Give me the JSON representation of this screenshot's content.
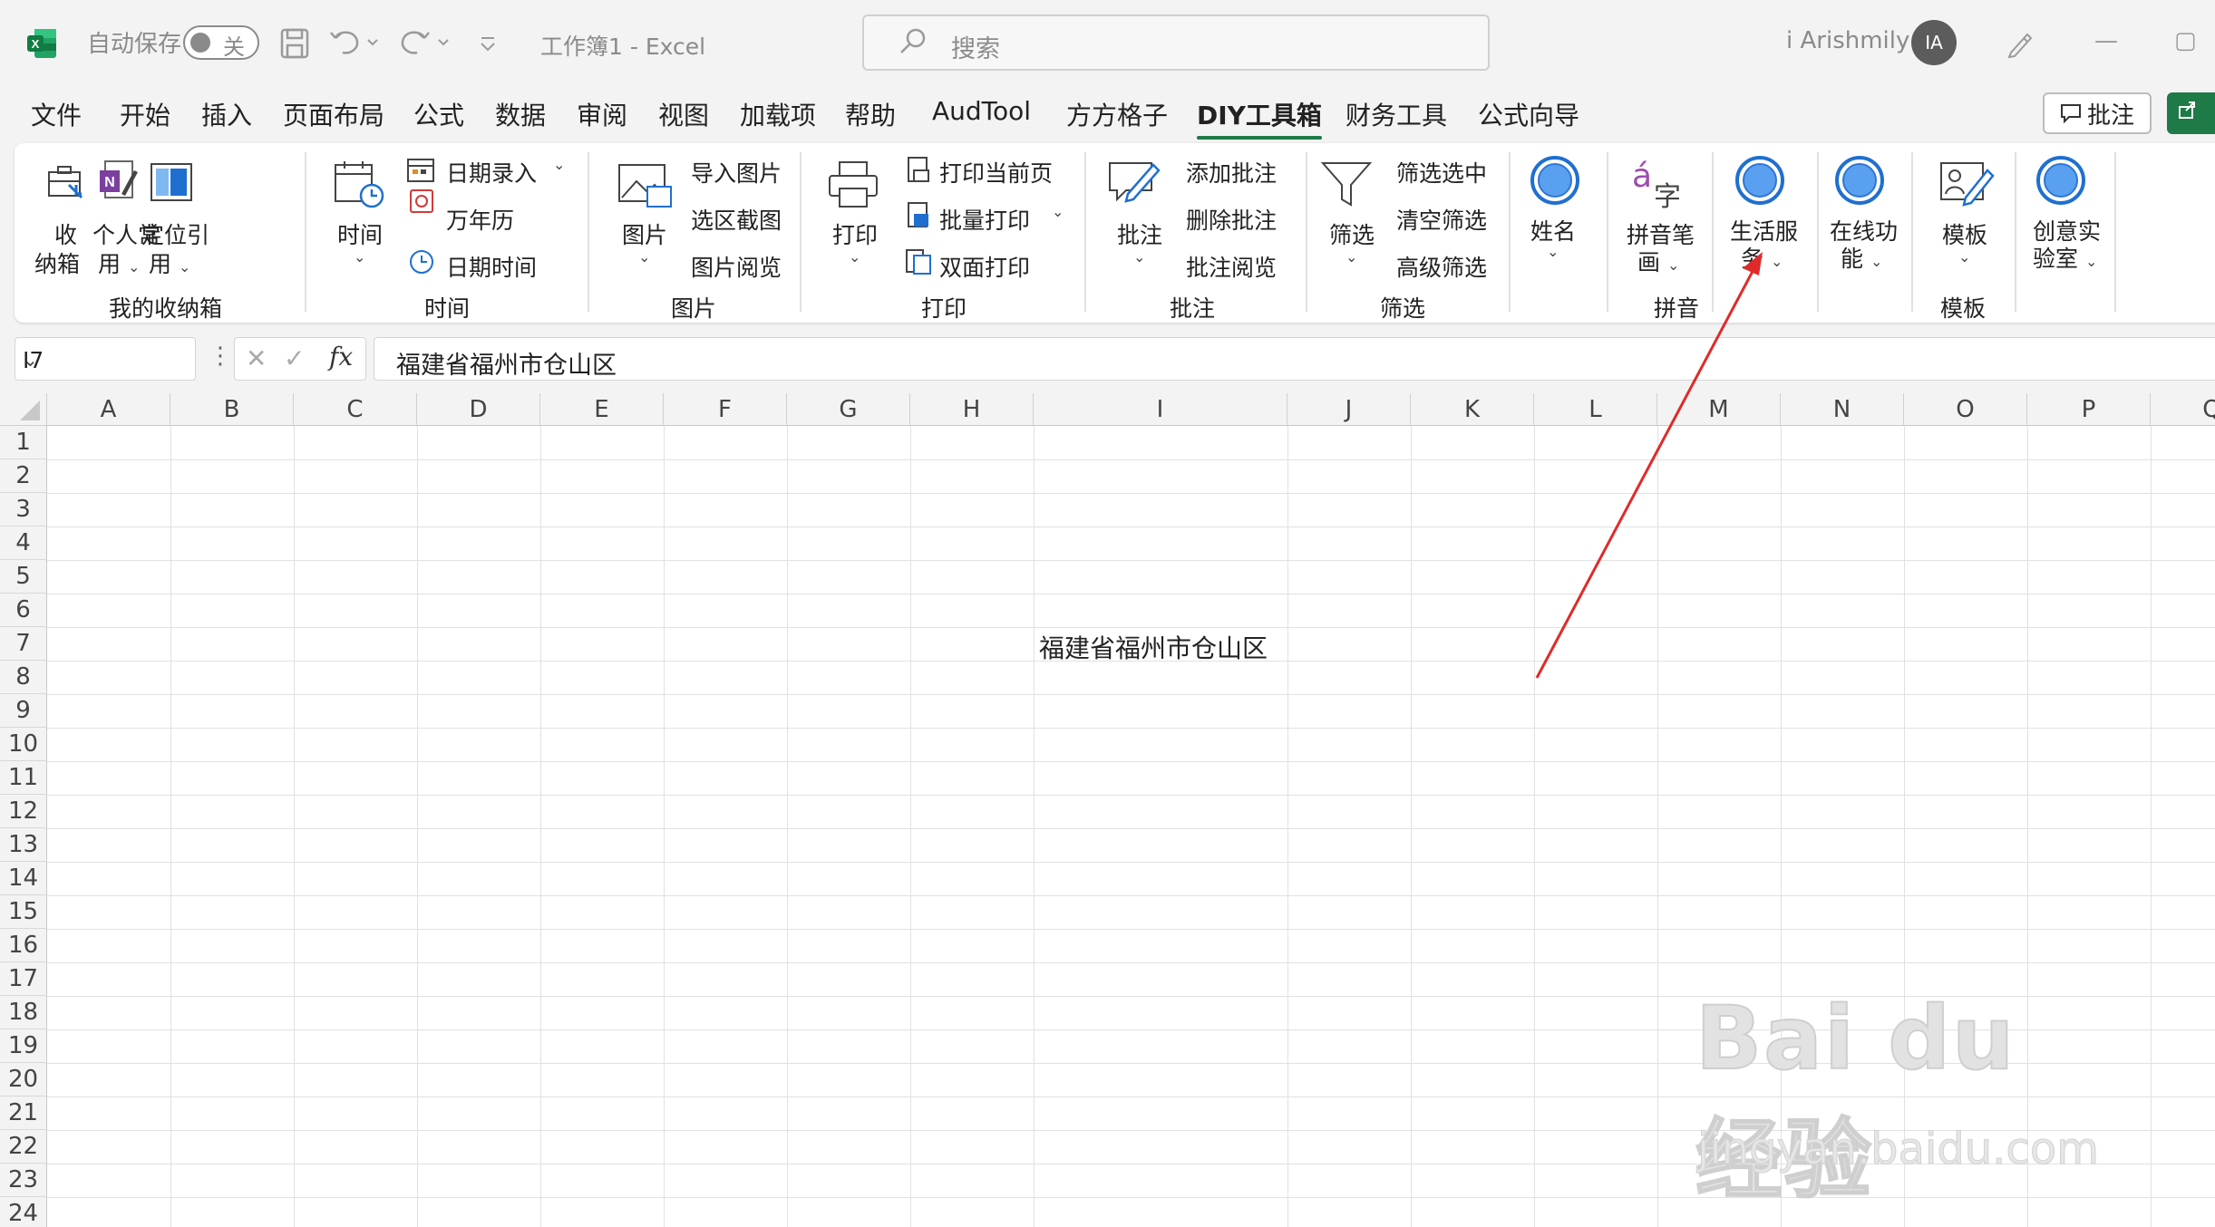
{
  "titlebar": {
    "autosave_label": "自动保存",
    "autosave_state": "关",
    "doc_title": "工作簿1  -  Excel",
    "search_placeholder": "搜索",
    "username": "i Arishmily",
    "avatar_initials": "IA"
  },
  "tabs": [
    "文件",
    "开始",
    "插入",
    "页面布局",
    "公式",
    "数据",
    "审阅",
    "视图",
    "加载项",
    "帮助",
    "AudTool",
    "方方格子",
    "DIY工具箱",
    "财务工具",
    "公式向导"
  ],
  "active_tab": "DIY工具箱",
  "comment_button": "批注",
  "ribbon": {
    "groups": {
      "storage": {
        "title": "我的收纳箱",
        "btn1_l1": "收",
        "btn1_l2": "纳箱",
        "btn2_l1": "个人常",
        "btn2_l2": "用",
        "btn3_l1": "定位引",
        "btn3_l2": "用"
      },
      "time": {
        "title": "时间",
        "big": "时间",
        "item1": "日期录入",
        "item2": "万年历",
        "item3": "日期时间"
      },
      "picture": {
        "title": "图片",
        "big": "图片",
        "item1": "导入图片",
        "item2": "选区截图",
        "item3": "图片阅览"
      },
      "print": {
        "title": "打印",
        "big": "打印",
        "item1": "打印当前页",
        "item2": "批量打印",
        "item3": "双面打印"
      },
      "comment": {
        "title": "批注",
        "big": "批注",
        "item1": "添加批注",
        "item2": "删除批注",
        "item3": "批注阅览"
      },
      "filter": {
        "title": "筛选",
        "big": "筛选",
        "item1": "筛选选中",
        "item2": "清空筛选",
        "item3": "高级筛选"
      },
      "name": {
        "big": "姓名"
      },
      "pinyin": {
        "title": "拼音",
        "big_l1": "拼音笔",
        "big_l2": "画",
        "glyph_a": "á",
        "glyph_zi": "字"
      },
      "life": {
        "big_l1": "生活服",
        "big_l2": "务"
      },
      "online": {
        "big_l1": "在线功",
        "big_l2": "能"
      },
      "template": {
        "title": "模板",
        "big": "模板"
      },
      "lab": {
        "big_l1": "创意实",
        "big_l2": "验室"
      }
    }
  },
  "formula_bar": {
    "name_box": "I7",
    "fx_label": "fx",
    "content": "福建省福州市仓山区"
  },
  "grid": {
    "columns": [
      "A",
      "B",
      "C",
      "D",
      "E",
      "F",
      "G",
      "H",
      "I",
      "J",
      "K",
      "L",
      "M",
      "N",
      "O",
      "P",
      "Q"
    ],
    "rows": [
      "1",
      "2",
      "3",
      "4",
      "5",
      "6",
      "7",
      "8",
      "9",
      "10",
      "11",
      "12",
      "13",
      "14",
      "15",
      "16",
      "17",
      "18",
      "19",
      "20",
      "21",
      "22",
      "23",
      "24"
    ],
    "cell_I7": "福建省福州市仓山区"
  },
  "watermark": {
    "logo": "Bai du 经验",
    "url": "jingyan.baidu.com"
  },
  "colors": {
    "excel_green": "#1e7a46",
    "annotation_red": "#e02a2a",
    "circle_blue": "#1f6fd0"
  }
}
